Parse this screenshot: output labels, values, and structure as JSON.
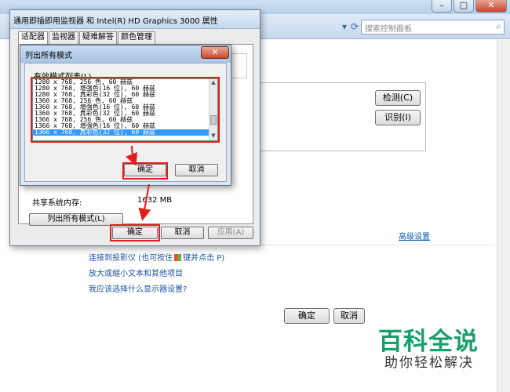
{
  "background": {
    "search_placeholder": "搜索控制面板",
    "detect_button": "检测(C)",
    "identify_button": "识别(I)",
    "advanced_link": "高级设置",
    "link_projector_pre": "连接到投影仪 (也可按住",
    "link_projector_post": "键并点击 P)",
    "link_magnify": "放大或缩小文本和其他项目",
    "link_which": "我应该选择什么显示器设置?",
    "ok_button": "确定",
    "cancel_button": "取消"
  },
  "properties_dialog": {
    "title": "通用即插即用监视器 和 Intel(R) HD Graphics 3000 属性",
    "tabs": [
      {
        "label": "适配器"
      },
      {
        "label": "监视器"
      },
      {
        "label": "疑难解答"
      },
      {
        "label": "颜色管理"
      }
    ],
    "shared_memory_label": "共享系统内存:",
    "shared_memory_value": "1632 MB",
    "list_all_modes_button": "列出所有模式(L)",
    "ok_button": "确定",
    "cancel_button": "取消",
    "apply_button": "应用(A)"
  },
  "modes_dialog": {
    "title": "列出所有模式",
    "list_label": "有效模式列表(L)",
    "modes": [
      {
        "text": "1280 x 768, 256 色, 60 赫兹",
        "selected": false
      },
      {
        "text": "1280 x 768, 增强色(16 位), 60 赫兹",
        "selected": false
      },
      {
        "text": "1280 x 768, 真彩色(32 位), 60 赫兹",
        "selected": false
      },
      {
        "text": "1360 x 768, 256 色, 60 赫兹",
        "selected": false
      },
      {
        "text": "1360 x 768, 增强色(16 位), 60 赫兹",
        "selected": false
      },
      {
        "text": "1360 x 768, 真彩色(32 位), 60 赫兹",
        "selected": false
      },
      {
        "text": "1366 x 768, 256 色, 60 赫兹",
        "selected": false
      },
      {
        "text": "1366 x 768, 增强色(16 位), 60 赫兹",
        "selected": false
      },
      {
        "text": "1366 x 768, 真彩色(32 位), 60 赫兹",
        "selected": true
      }
    ],
    "ok_button": "确定",
    "cancel_button": "取消"
  },
  "watermark": {
    "main": "百科全说",
    "sub": "助你轻松解决"
  },
  "colors": {
    "highlight_red": "#e31c1c",
    "selection_blue": "#3399ff",
    "link_blue": "#1c53a6",
    "watermark_green": "#18a06a"
  }
}
